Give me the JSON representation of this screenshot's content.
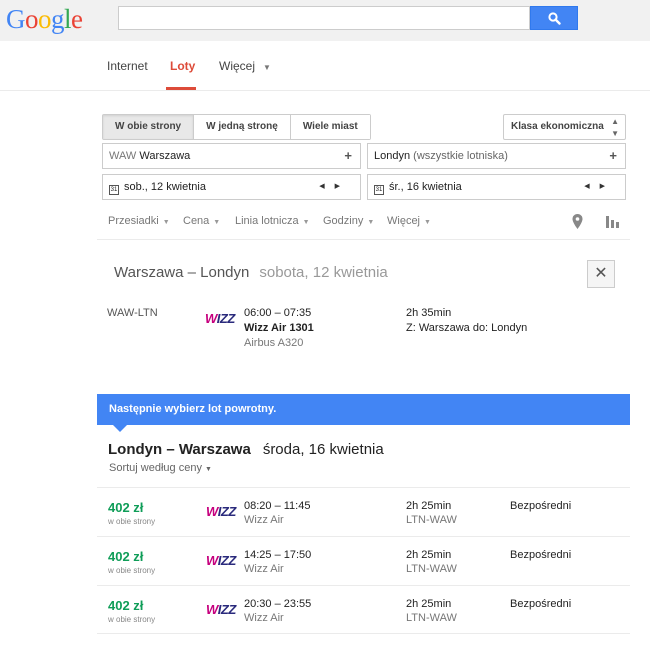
{
  "header": {
    "logo_letters": [
      "G",
      "o",
      "o",
      "g",
      "l",
      "e"
    ],
    "search": {
      "value": "",
      "placeholder": ""
    },
    "search_icon": "search-icon"
  },
  "tabs": [
    {
      "label": "Internet",
      "active": false
    },
    {
      "label": "Loty",
      "active": true
    },
    {
      "label": "Więcej",
      "active": false
    }
  ],
  "form": {
    "trip_types": [
      "W obie strony",
      "W jedną stronę",
      "Wiele miast"
    ],
    "trip_type_selected": "W obie strony",
    "cabin": "Klasa ekonomiczna",
    "origin": {
      "code": "WAW",
      "name": "Warszawa"
    },
    "destination": {
      "name": "Londyn",
      "suffix": "(wszystkie lotniska)"
    },
    "depart_date": "sob., 12 kwietnia",
    "return_date": "śr., 16 kwietnia",
    "calendar_glyph": "31"
  },
  "filters": {
    "items": [
      "Przesiadki",
      "Cena",
      "Linia lotnicza",
      "Godziny",
      "Więcej"
    ],
    "icons": [
      "map-pin-icon",
      "bar-chart-icon"
    ]
  },
  "outbound": {
    "route": "Warszawa – Londyn",
    "date": "sobota, 12 kwietnia",
    "segment": "WAW-LTN",
    "airline_logo_left": "W",
    "airline_logo_right": "IZZ",
    "times": "06:00 – 07:35",
    "flight": "Wizz Air 1301",
    "aircraft": "Airbus A320",
    "duration": "2h 35min",
    "from_to": "Z: Warszawa do: Londyn",
    "close_symbol": "✕"
  },
  "banner": "Następnie wybierz lot powrotny.",
  "return": {
    "route": "Londyn – Warszawa",
    "date": "środa, 16 kwietnia",
    "sort_label": "Sortuj według ceny",
    "flights": [
      {
        "price": "402 zł",
        "price_note": "w obie strony",
        "logo_left": "W",
        "logo_right": "IZZ",
        "times": "08:20 – 11:45",
        "airline": "Wizz Air",
        "duration": "2h 25min",
        "route": "LTN-WAW",
        "stops": "Bezpośredni"
      },
      {
        "price": "402 zł",
        "price_note": "w obie strony",
        "logo_left": "W",
        "logo_right": "IZZ",
        "times": "14:25 – 17:50",
        "airline": "Wizz Air",
        "duration": "2h 25min",
        "route": "LTN-WAW",
        "stops": "Bezpośredni"
      },
      {
        "price": "402 zł",
        "price_note": "w obie strony",
        "logo_left": "W",
        "logo_right": "IZZ",
        "times": "20:30 – 23:55",
        "airline": "Wizz Air",
        "duration": "2h 25min",
        "route": "LTN-WAW",
        "stops": "Bezpośredni"
      }
    ]
  },
  "colors": {
    "brand_blue": "#4285f4",
    "accent_red": "#dd4b39",
    "price_green": "#0f9d58",
    "wizz_magenta": "#c6007e",
    "wizz_navy": "#2a2a7c"
  }
}
